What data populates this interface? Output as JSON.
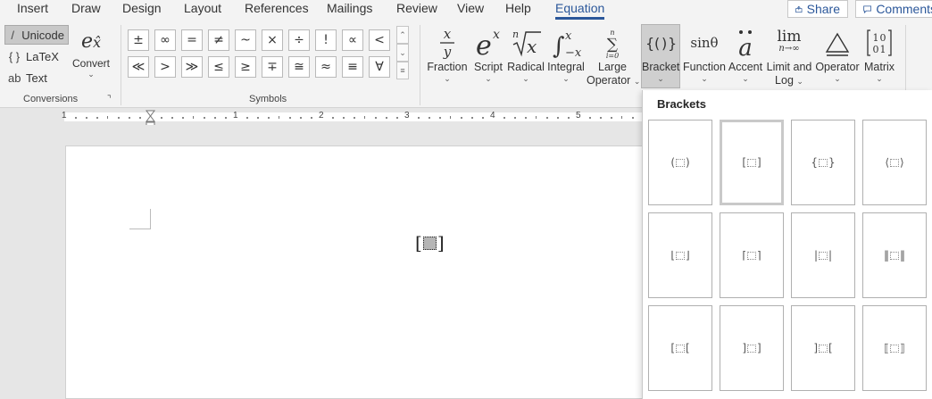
{
  "tabs": [
    {
      "label": "Insert",
      "active": false
    },
    {
      "label": "Draw",
      "active": false
    },
    {
      "label": "Design",
      "active": false
    },
    {
      "label": "Layout",
      "active": false
    },
    {
      "label": "References",
      "active": false
    },
    {
      "label": "Mailings",
      "active": false
    },
    {
      "label": "Review",
      "active": false
    },
    {
      "label": "View",
      "active": false
    },
    {
      "label": "Help",
      "active": false
    },
    {
      "label": "Equation",
      "active": true
    }
  ],
  "share_label": "Share",
  "comments_label": "Comments",
  "conversions": {
    "group_label": "Conversions",
    "unicode_label": "Unicode",
    "latex_label": "LaTeX",
    "text_label": "Text",
    "text_icon": "ab",
    "convert_label": "Convert"
  },
  "symbols": {
    "group_label": "Symbols",
    "row1": [
      "±",
      "∞",
      "=",
      "≠",
      "~",
      "×",
      "÷",
      "!",
      "∝",
      "<"
    ],
    "row2": [
      "≪",
      ">",
      "≫",
      "≤",
      "≥",
      "∓",
      "≅",
      "≈",
      "≡",
      "∀"
    ]
  },
  "structures": {
    "fraction": "Fraction",
    "script": "Script",
    "radical": "Radical",
    "integral": "Integral",
    "large_operator_1": "Large",
    "large_operator_2": "Operator",
    "bracket": "Bracket",
    "function": "Function",
    "function_glyph": "sinθ",
    "accent": "Accent",
    "limit_1": "Limit and",
    "limit_2": "Log",
    "limit_glyph": "lim",
    "limit_sub": "n→∞",
    "operator": "Operator",
    "matrix": "Matrix"
  },
  "ruler_numbers": [
    "1",
    "1",
    "2",
    "3",
    "4",
    "5"
  ],
  "brackets_panel": {
    "title": "Brackets",
    "items": [
      {
        "left": "(",
        "right": ")"
      },
      {
        "left": "[",
        "right": "]"
      },
      {
        "left": "{",
        "right": "}"
      },
      {
        "left": "⟨",
        "right": "⟩"
      },
      {
        "left": "⌊",
        "right": "⌋"
      },
      {
        "left": "⌈",
        "right": "⌉"
      },
      {
        "left": "|",
        "right": "|"
      },
      {
        "left": "‖",
        "right": "‖"
      },
      {
        "left": "[",
        "right": "["
      },
      {
        "left": "]",
        "right": "]"
      },
      {
        "left": "]",
        "right": "["
      },
      {
        "left": "⟦",
        "right": "⟧"
      }
    ]
  },
  "equation": {
    "left": "[",
    "right": "]"
  }
}
